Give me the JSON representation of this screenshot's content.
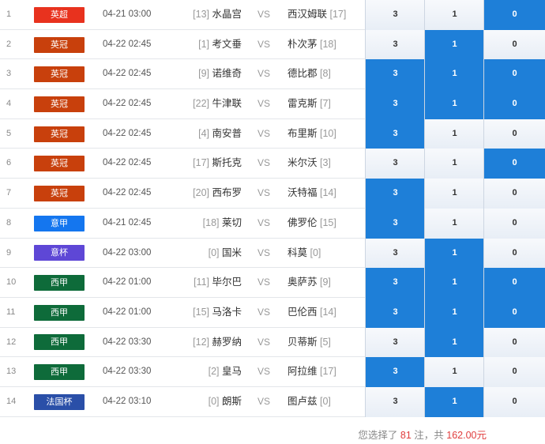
{
  "matches": [
    {
      "idx": "1",
      "league": "英超",
      "league_color": "#e8321e",
      "time": "04-21 03:00",
      "home_rank": "[13]",
      "home": "水晶宫",
      "vs": "VS",
      "away": "西汉姆联",
      "away_rank": "[17]",
      "options": [
        "3",
        "1",
        "0"
      ],
      "selected": [
        false,
        false,
        true
      ]
    },
    {
      "idx": "2",
      "league": "英冠",
      "league_color": "#c8400c",
      "time": "04-22 02:45",
      "home_rank": "[1]",
      "home": "考文垂",
      "vs": "VS",
      "away": "朴次茅",
      "away_rank": "[18]",
      "options": [
        "3",
        "1",
        "0"
      ],
      "selected": [
        false,
        true,
        false
      ]
    },
    {
      "idx": "3",
      "league": "英冠",
      "league_color": "#c8400c",
      "time": "04-22 02:45",
      "home_rank": "[9]",
      "home": "诺维奇",
      "vs": "VS",
      "away": "德比郡",
      "away_rank": "[8]",
      "options": [
        "3",
        "1",
        "0"
      ],
      "selected": [
        true,
        true,
        true
      ]
    },
    {
      "idx": "4",
      "league": "英冠",
      "league_color": "#c8400c",
      "time": "04-22 02:45",
      "home_rank": "[22]",
      "home": "牛津联",
      "vs": "VS",
      "away": "雷克斯",
      "away_rank": "[7]",
      "options": [
        "3",
        "1",
        "0"
      ],
      "selected": [
        true,
        true,
        true
      ]
    },
    {
      "idx": "5",
      "league": "英冠",
      "league_color": "#c8400c",
      "time": "04-22 02:45",
      "home_rank": "[4]",
      "home": "南安普",
      "vs": "VS",
      "away": "布里斯",
      "away_rank": "[10]",
      "options": [
        "3",
        "1",
        "0"
      ],
      "selected": [
        true,
        false,
        false
      ]
    },
    {
      "idx": "6",
      "league": "英冠",
      "league_color": "#c8400c",
      "time": "04-22 02:45",
      "home_rank": "[17]",
      "home": "斯托克",
      "vs": "VS",
      "away": "米尔沃",
      "away_rank": "[3]",
      "options": [
        "3",
        "1",
        "0"
      ],
      "selected": [
        false,
        false,
        true
      ]
    },
    {
      "idx": "7",
      "league": "英冠",
      "league_color": "#c8400c",
      "time": "04-22 02:45",
      "home_rank": "[20]",
      "home": "西布罗",
      "vs": "VS",
      "away": "沃特福",
      "away_rank": "[14]",
      "options": [
        "3",
        "1",
        "0"
      ],
      "selected": [
        true,
        false,
        false
      ]
    },
    {
      "idx": "8",
      "league": "意甲",
      "league_color": "#1476ef",
      "time": "04-21 02:45",
      "home_rank": "[18]",
      "home": "莱切",
      "vs": "VS",
      "away": "佛罗伦",
      "away_rank": "[15]",
      "options": [
        "3",
        "1",
        "0"
      ],
      "selected": [
        true,
        false,
        false
      ]
    },
    {
      "idx": "9",
      "league": "意杯",
      "league_color": "#5e47d6",
      "time": "04-22 03:00",
      "home_rank": "[0]",
      "home": "国米",
      "vs": "VS",
      "away": "科莫",
      "away_rank": "[0]",
      "options": [
        "3",
        "1",
        "0"
      ],
      "selected": [
        false,
        true,
        false
      ]
    },
    {
      "idx": "10",
      "league": "西甲",
      "league_color": "#0e6b3a",
      "time": "04-22 01:00",
      "home_rank": "[11]",
      "home": "毕尔巴",
      "vs": "VS",
      "away": "奥萨苏",
      "away_rank": "[9]",
      "options": [
        "3",
        "1",
        "0"
      ],
      "selected": [
        true,
        true,
        true
      ]
    },
    {
      "idx": "11",
      "league": "西甲",
      "league_color": "#0e6b3a",
      "time": "04-22 01:00",
      "home_rank": "[15]",
      "home": "马洛卡",
      "vs": "VS",
      "away": "巴伦西",
      "away_rank": "[14]",
      "options": [
        "3",
        "1",
        "0"
      ],
      "selected": [
        true,
        true,
        true
      ]
    },
    {
      "idx": "12",
      "league": "西甲",
      "league_color": "#0e6b3a",
      "time": "04-22 03:30",
      "home_rank": "[12]",
      "home": "赫罗纳",
      "vs": "VS",
      "away": "贝蒂斯",
      "away_rank": "[5]",
      "options": [
        "3",
        "1",
        "0"
      ],
      "selected": [
        false,
        true,
        false
      ]
    },
    {
      "idx": "13",
      "league": "西甲",
      "league_color": "#0e6b3a",
      "time": "04-22 03:30",
      "home_rank": "[2]",
      "home": "皇马",
      "vs": "VS",
      "away": "阿拉维",
      "away_rank": "[17]",
      "options": [
        "3",
        "1",
        "0"
      ],
      "selected": [
        true,
        false,
        false
      ]
    },
    {
      "idx": "14",
      "league": "法国杯",
      "league_color": "#2a4fa8",
      "time": "04-22 03:10",
      "home_rank": "[0]",
      "home": "朗斯",
      "vs": "VS",
      "away": "图卢兹",
      "away_rank": "[0]",
      "options": [
        "3",
        "1",
        "0"
      ],
      "selected": [
        false,
        true,
        false
      ]
    }
  ],
  "summary": {
    "prefix": "您选择了",
    "count": "81",
    "mid": "注，共",
    "amount": "162.00元"
  }
}
